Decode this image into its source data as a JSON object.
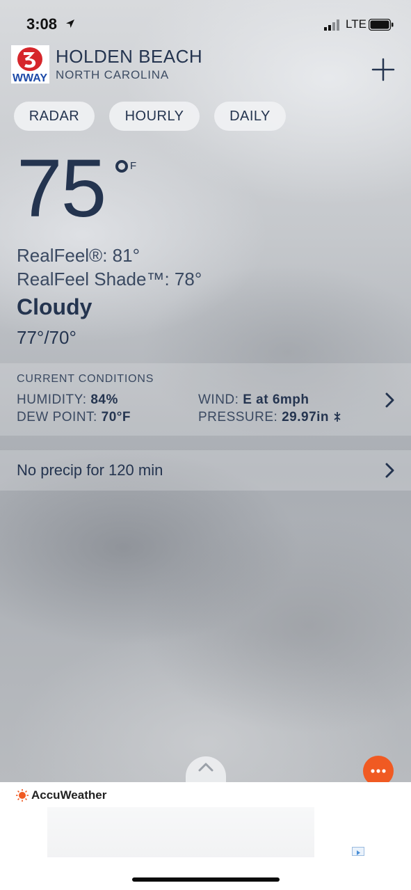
{
  "status_bar": {
    "time": "3:08",
    "network": "LTE"
  },
  "header": {
    "logo_text": "WWAY",
    "logo_number": "3",
    "city": "HOLDEN BEACH",
    "state": "NORTH CAROLINA"
  },
  "tabs": [
    {
      "label": "RADAR"
    },
    {
      "label": "HOURLY"
    },
    {
      "label": "DAILY"
    }
  ],
  "current": {
    "temperature": "75",
    "unit": "F",
    "realfeel": "RealFeel®: 81°",
    "realfeel_shade": "RealFeel Shade™: 78°",
    "condition": "Cloudy",
    "hi_lo": "77°/70°"
  },
  "current_conditions": {
    "title": "CURRENT CONDITIONS",
    "humidity_label": "HUMIDITY:",
    "humidity_value": "84%",
    "dew_point_label": "DEW POINT:",
    "dew_point_value": "70°F",
    "wind_label": "WIND:",
    "wind_value": "E at 6mph",
    "pressure_label": "PRESSURE:",
    "pressure_value": "29.97in"
  },
  "precip": {
    "text": "No precip for 120 min"
  },
  "footer": {
    "brand": "AccuWeather"
  },
  "colors": {
    "text_primary": "#24344f",
    "accent_orange": "#f05a22",
    "logo_red": "#d6262b",
    "logo_blue": "#1d4aa8"
  },
  "icons": [
    "location-arrow-icon",
    "signal-icon",
    "battery-icon",
    "plus-icon",
    "chevron-right-icon",
    "pressure-steady-icon",
    "chevron-up-icon",
    "more-dots-icon",
    "accuweather-sun-icon",
    "adchoices-icon"
  ]
}
